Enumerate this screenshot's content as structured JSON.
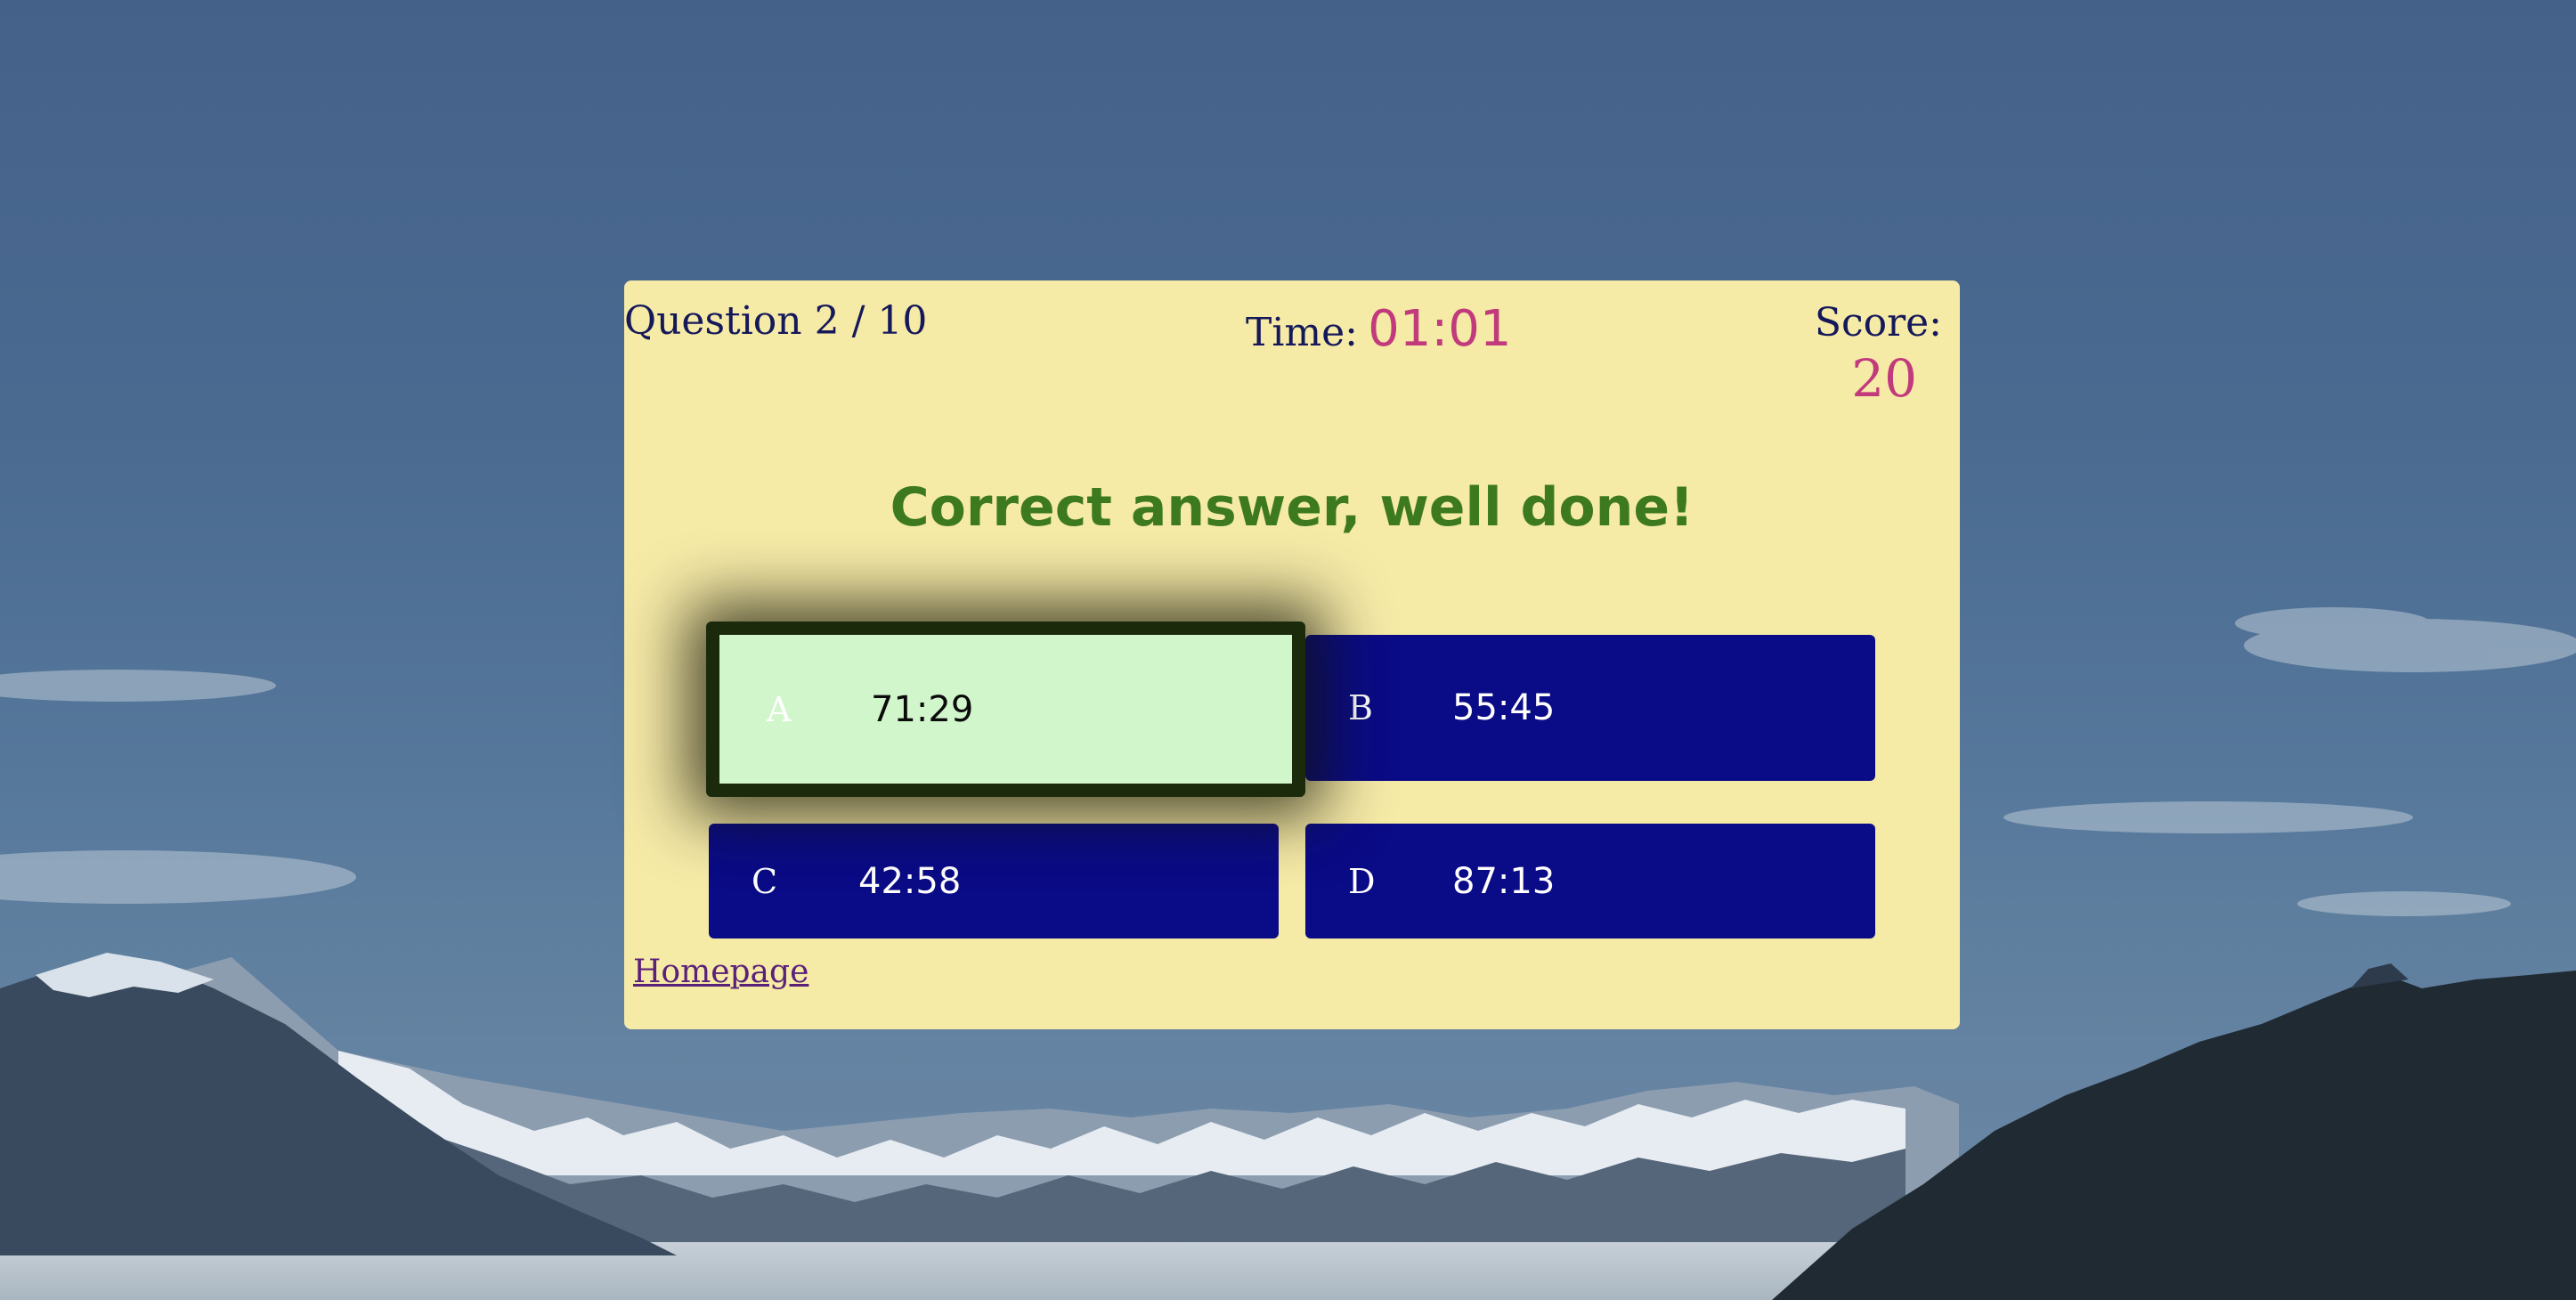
{
  "header": {
    "question_counter": "Question 2 / 10",
    "time_label": "Time:",
    "time_value": "01:01",
    "score_label": "Score:",
    "score_value": "20"
  },
  "feedback": {
    "message": "Correct answer, well done!"
  },
  "answers": [
    {
      "letter": "A",
      "value": "71:29",
      "selected": true
    },
    {
      "letter": "B",
      "value": "55:45",
      "selected": false
    },
    {
      "letter": "C",
      "value": "42:58",
      "selected": false
    },
    {
      "letter": "D",
      "value": "87:13",
      "selected": false
    }
  ],
  "footer": {
    "homepage_link": "Homepage"
  },
  "colors": {
    "card_background": "#f6eaa7",
    "answer_button": "#0a0b86",
    "correct_answer": "#d2f6cc",
    "accent": "#c13a7c",
    "feedback_text": "#3d7a1f",
    "header_text": "#15195a"
  }
}
